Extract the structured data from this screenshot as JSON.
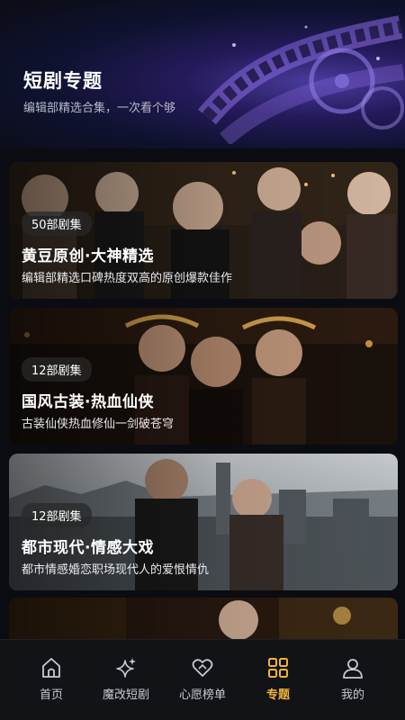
{
  "header": {
    "title": "短剧专题",
    "subtitle": "编辑部精选合集，一次看个够"
  },
  "cards": [
    {
      "badge": "50部剧集",
      "title": "黄豆原创·大神精选",
      "description": "编辑部精选口碑热度双高的原创爆款佳作"
    },
    {
      "badge": "12部剧集",
      "title": "国风古装·热血仙侠",
      "description": "古装仙侠热血修仙一剑破苍穹"
    },
    {
      "badge": "12部剧集",
      "title": "都市现代·情感大戏",
      "description": "都市情感婚恋职场现代人的爱恨情仇"
    },
    {
      "badge": "",
      "title": "",
      "description": ""
    }
  ],
  "tabbar": {
    "items": [
      {
        "label": "首页",
        "icon": "home-icon"
      },
      {
        "label": "魔改短剧",
        "icon": "sparkle-icon"
      },
      {
        "label": "心愿榜单",
        "icon": "heart-icon"
      },
      {
        "label": "专题",
        "icon": "grid-icon",
        "active": true
      },
      {
        "label": "我的",
        "icon": "user-icon"
      }
    ],
    "active_color": "#f2b43a",
    "inactive_color": "#c9cad0"
  }
}
